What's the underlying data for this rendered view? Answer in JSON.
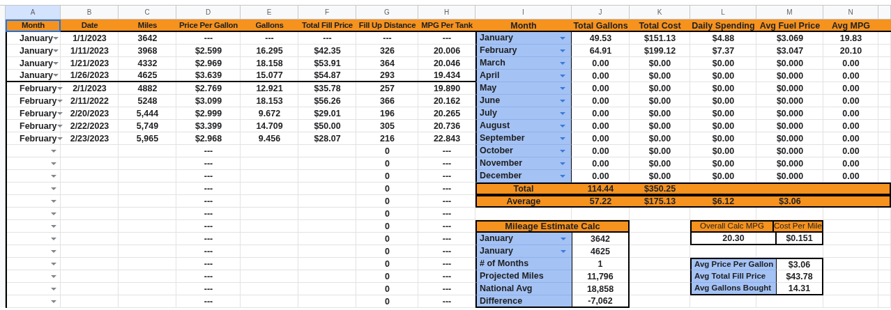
{
  "column_letters": [
    "A",
    "B",
    "C",
    "D",
    "E",
    "F",
    "G",
    "H",
    "I",
    "J",
    "K",
    "L",
    "M",
    "N"
  ],
  "log_table": {
    "columns": [
      {
        "label": "Month",
        "selected": true
      },
      {
        "label": "Date",
        "selected": false
      },
      {
        "label": "Miles",
        "selected": false
      },
      {
        "label": "Price Per Gallon",
        "selected": false
      },
      {
        "label": "Gallons",
        "selected": false
      },
      {
        "label": "Total Fill Price",
        "selected": false
      },
      {
        "label": "Fill Up Distance",
        "selected": false
      },
      {
        "label": "MPG Per Tank",
        "selected": false
      }
    ],
    "rows": [
      {
        "month": "January",
        "date": "1/1/2023",
        "miles": "3642",
        "price_per_gallon": "---",
        "gallons": "---",
        "total_fill_price": "---",
        "fill_up_distance": "---",
        "mpg_per_tank": "---",
        "divider_below": false
      },
      {
        "month": "January",
        "date": "1/11/2023",
        "miles": "3968",
        "price_per_gallon": "$2.599",
        "gallons": "16.295",
        "total_fill_price": "$42.35",
        "fill_up_distance": "326",
        "mpg_per_tank": "20.006",
        "divider_below": false
      },
      {
        "month": "January",
        "date": "1/21/2023",
        "miles": "4332",
        "price_per_gallon": "$2.969",
        "gallons": "18.158",
        "total_fill_price": "$53.91",
        "fill_up_distance": "364",
        "mpg_per_tank": "20.046",
        "divider_below": false
      },
      {
        "month": "January",
        "date": "1/26/2023",
        "miles": "4625",
        "price_per_gallon": "$3.639",
        "gallons": "15.077",
        "total_fill_price": "$54.87",
        "fill_up_distance": "293",
        "mpg_per_tank": "19.434",
        "divider_below": true
      },
      {
        "month": "February",
        "date": "2/1/2023",
        "miles": "4882",
        "price_per_gallon": "$2.769",
        "gallons": "12.921",
        "total_fill_price": "$35.78",
        "fill_up_distance": "257",
        "mpg_per_tank": "19.890",
        "divider_below": false
      },
      {
        "month": "February",
        "date": "2/11/2022",
        "miles": "5248",
        "price_per_gallon": "$3.099",
        "gallons": "18.153",
        "total_fill_price": "$56.26",
        "fill_up_distance": "366",
        "mpg_per_tank": "20.162",
        "divider_below": false
      },
      {
        "month": "February",
        "date": "2/20/2023",
        "miles": "5,444",
        "price_per_gallon": "$2.999",
        "gallons": "9.672",
        "total_fill_price": "$29.01",
        "fill_up_distance": "196",
        "mpg_per_tank": "20.265",
        "divider_below": false
      },
      {
        "month": "February",
        "date": "2/22/2023",
        "miles": "5,749",
        "price_per_gallon": "$3.399",
        "gallons": "14.709",
        "total_fill_price": "$50.00",
        "fill_up_distance": "305",
        "mpg_per_tank": "20.736",
        "divider_below": false
      },
      {
        "month": "February",
        "date": "2/23/2023",
        "miles": "5,965",
        "price_per_gallon": "$2.968",
        "gallons": "9.456",
        "total_fill_price": "$28.07",
        "fill_up_distance": "216",
        "mpg_per_tank": "22.843",
        "divider_below": false
      },
      {
        "price_per_gallon": "---",
        "fill_up_distance": "0",
        "mpg_per_tank": "---",
        "divider_below": false
      },
      {
        "price_per_gallon": "---",
        "fill_up_distance": "0",
        "mpg_per_tank": "---",
        "divider_below": false
      },
      {
        "price_per_gallon": "---",
        "fill_up_distance": "0",
        "mpg_per_tank": "---",
        "divider_below": false
      },
      {
        "price_per_gallon": "---",
        "fill_up_distance": "0",
        "mpg_per_tank": "---",
        "divider_below": false
      },
      {
        "price_per_gallon": "---",
        "fill_up_distance": "0",
        "mpg_per_tank": "---",
        "divider_below": false
      },
      {
        "price_per_gallon": "---",
        "fill_up_distance": "0",
        "mpg_per_tank": "---",
        "divider_below": false
      },
      {
        "price_per_gallon": "---",
        "fill_up_distance": "0",
        "mpg_per_tank": "---",
        "divider_below": false
      },
      {
        "price_per_gallon": "---",
        "fill_up_distance": "0",
        "mpg_per_tank": "---",
        "divider_below": false
      },
      {
        "price_per_gallon": "---",
        "fill_up_distance": "0",
        "mpg_per_tank": "---",
        "divider_below": false
      },
      {
        "price_per_gallon": "---",
        "fill_up_distance": "0",
        "mpg_per_tank": "---",
        "divider_below": false
      },
      {
        "price_per_gallon": "---",
        "fill_up_distance": "0",
        "mpg_per_tank": "---",
        "divider_below": false
      },
      {
        "price_per_gallon": "---",
        "fill_up_distance": "0",
        "mpg_per_tank": "---",
        "divider_below": false
      },
      {
        "price_per_gallon": "---",
        "fill_up_distance": "0",
        "mpg_per_tank": "---",
        "divider_below": false
      }
    ]
  },
  "monthly_summary": {
    "columns": [
      "Month",
      "Total Gallons",
      "Total Cost",
      "Daily Spending",
      "Avg Fuel Price",
      "Avg MPG"
    ],
    "rows": [
      {
        "month": "January",
        "values": [
          "49.53",
          "$151.13",
          "$4.88",
          "$3.069",
          "19.83"
        ]
      },
      {
        "month": "February",
        "values": [
          "64.91",
          "$199.12",
          "$7.37",
          "$3.047",
          "20.10"
        ]
      },
      {
        "month": "March",
        "values": [
          "0.00",
          "$0.00",
          "$0.00",
          "$0.000",
          "0.00"
        ]
      },
      {
        "month": "April",
        "values": [
          "0.00",
          "$0.00",
          "$0.00",
          "$0.000",
          "0.00"
        ]
      },
      {
        "month": "May",
        "values": [
          "0.00",
          "$0.00",
          "$0.00",
          "$0.000",
          "0.00"
        ]
      },
      {
        "month": "June",
        "values": [
          "0.00",
          "$0.00",
          "$0.00",
          "$0.000",
          "0.00"
        ]
      },
      {
        "month": "July",
        "values": [
          "0.00",
          "$0.00",
          "$0.00",
          "$0.000",
          "0.00"
        ]
      },
      {
        "month": "August",
        "values": [
          "0.00",
          "$0.00",
          "$0.00",
          "$0.000",
          "0.00"
        ]
      },
      {
        "month": "September",
        "values": [
          "0.00",
          "$0.00",
          "$0.00",
          "$0.000",
          "0.00"
        ]
      },
      {
        "month": "October",
        "values": [
          "0.00",
          "$0.00",
          "$0.00",
          "$0.000",
          "0.00"
        ]
      },
      {
        "month": "November",
        "values": [
          "0.00",
          "$0.00",
          "$0.00",
          "$0.000",
          "0.00"
        ]
      },
      {
        "month": "December",
        "values": [
          "0.00",
          "$0.00",
          "$0.00",
          "$0.000",
          "0.00"
        ]
      }
    ],
    "summary_rows": [
      {
        "label": "Total",
        "values": [
          "114.44",
          "$350.25"
        ]
      },
      {
        "label": "Average",
        "values": [
          "57.22",
          "$175.13",
          "$6.12",
          "$3.06"
        ]
      }
    ]
  },
  "mileage_estimate": {
    "title": "Mileage Estimate Calc",
    "rows": [
      {
        "kind": "dropdown",
        "label": "January",
        "value": "3642"
      },
      {
        "kind": "dropdown",
        "label": "January",
        "value": "4625"
      },
      {
        "kind": "plain",
        "label": "# of Months",
        "value": "1"
      },
      {
        "kind": "plain",
        "label": "Projected Miles",
        "value": "11,796"
      },
      {
        "kind": "plain",
        "label": "National Avg",
        "value": "18,858"
      },
      {
        "kind": "plain",
        "label": "Difference",
        "value": "-7,062"
      }
    ]
  },
  "overall": {
    "columns": [
      "Overall Calc MPG",
      "Cost Per Mile"
    ],
    "values": [
      "20.30",
      "$0.151"
    ]
  },
  "averages": [
    {
      "label": "Avg Price Per Gallon",
      "value": "$3.06"
    },
    {
      "label": "Avg Total Fill Price",
      "value": "$43.78"
    },
    {
      "label": "Avg Gallons Bought",
      "value": "14.31"
    }
  ]
}
